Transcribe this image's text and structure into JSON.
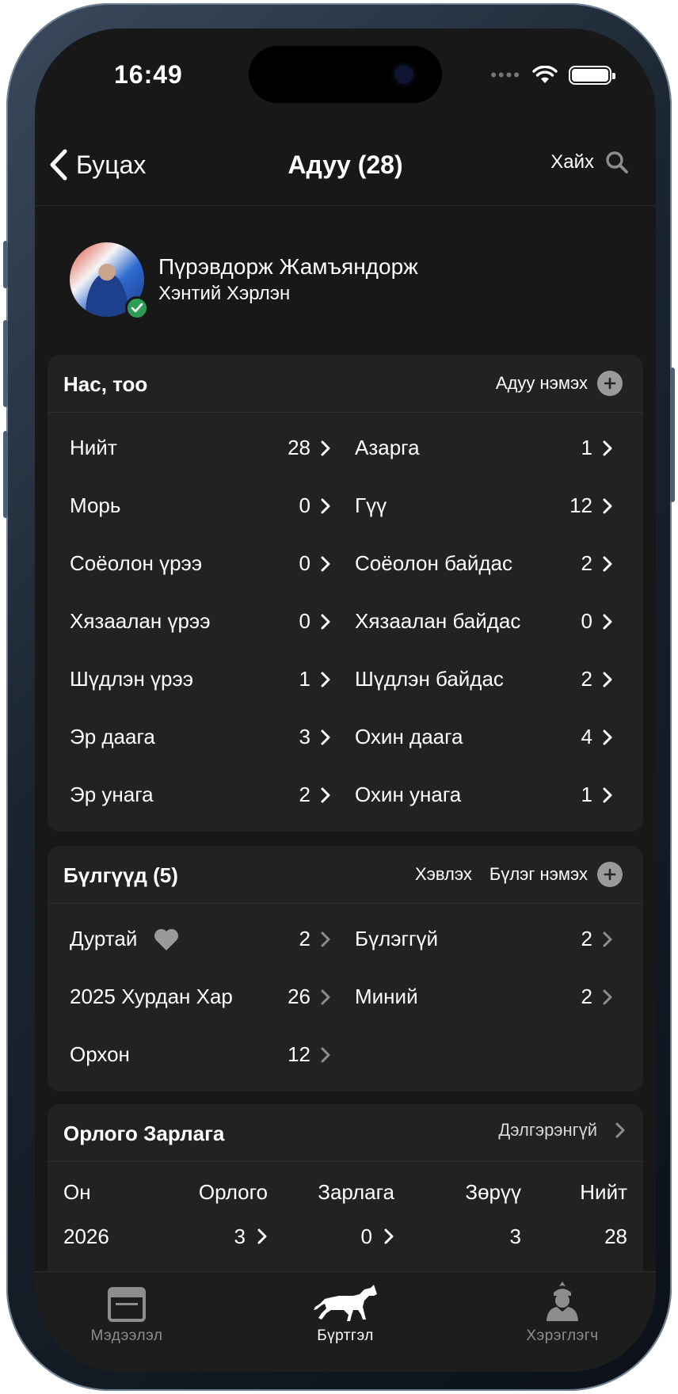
{
  "status": {
    "time": "16:49"
  },
  "nav": {
    "back_label": "Буцах",
    "title": "Адуу (28)",
    "search_label": "Хайх"
  },
  "profile": {
    "name": "Пүрэвдорж Жамъяндорж",
    "location": "Хэнтий Хэрлэн"
  },
  "age_card": {
    "title": "Нас, тоо",
    "action_label": "Адуу нэмэх",
    "items": [
      {
        "label": "Нийт",
        "value": "28"
      },
      {
        "label": "Азарга",
        "value": "1"
      },
      {
        "label": "Морь",
        "value": "0"
      },
      {
        "label": "Гүү",
        "value": "12"
      },
      {
        "label": "Соёолон үрээ",
        "value": "0"
      },
      {
        "label": "Соёолон байдас",
        "value": "2"
      },
      {
        "label": "Хязаалан үрээ",
        "value": "0"
      },
      {
        "label": "Хязаалан байдас",
        "value": "0"
      },
      {
        "label": "Шүдлэн үрээ",
        "value": "1"
      },
      {
        "label": "Шүдлэн байдас",
        "value": "2"
      },
      {
        "label": "Эр даага",
        "value": "3"
      },
      {
        "label": "Охин даага",
        "value": "4"
      },
      {
        "label": "Эр унага",
        "value": "2"
      },
      {
        "label": "Охин унага",
        "value": "1"
      }
    ]
  },
  "groups_card": {
    "title": "Бүлгүүд (5)",
    "print_label": "Хэвлэх",
    "add_label": "Бүлэг нэмэх",
    "items": [
      {
        "label": "Дуртай",
        "value": "2",
        "icon": "heart-icon"
      },
      {
        "label": "Бүлэггүй",
        "value": "2"
      },
      {
        "label": "2025 Хурдан Хар",
        "value": "26"
      },
      {
        "label": "Миний",
        "value": "2"
      },
      {
        "label": "Орхон",
        "value": "12"
      }
    ]
  },
  "finance_card": {
    "title": "Орлого Зарлага",
    "details_label": "Дэлгэрэнгүй",
    "headers": [
      "Он",
      "Орлого",
      "Зарлага",
      "Зөрүү",
      "Нийт"
    ],
    "rows": [
      {
        "year": "2026",
        "income": "3",
        "expense": "0",
        "diff": "3",
        "total": "28"
      }
    ]
  },
  "tabs": [
    {
      "label": "Мэдээлэл",
      "icon": "browser-window-icon",
      "active": false
    },
    {
      "label": "Бүртгэл",
      "icon": "horse-icon",
      "active": true
    },
    {
      "label": "Хэрэглэгч",
      "icon": "user-icon",
      "active": false
    }
  ],
  "colors": {
    "background": "#181818",
    "card": "#222222",
    "text": "#ffffff",
    "muted": "#8d8d8d",
    "verified": "#2e9c55"
  }
}
